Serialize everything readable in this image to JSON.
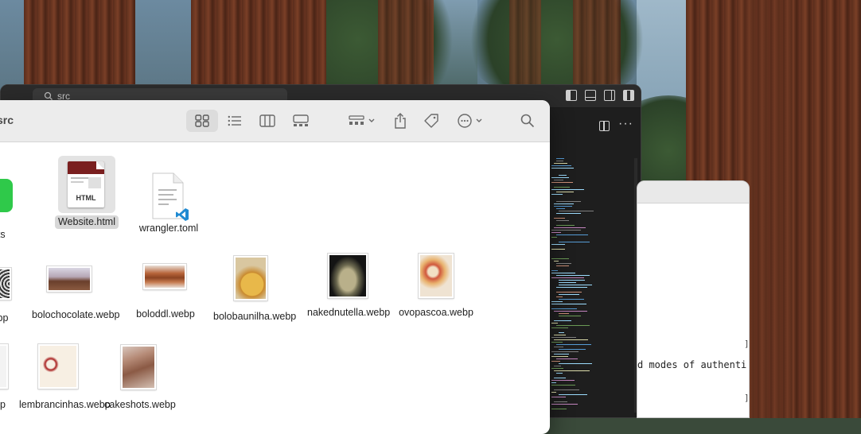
{
  "editor": {
    "command_center_text": "src",
    "layout_icons": [
      "toggle-primary-sidebar-icon",
      "toggle-panel-icon",
      "toggle-secondary-sidebar-icon",
      "customize-layout-icon"
    ],
    "more_actions": "···"
  },
  "finder": {
    "title": "src",
    "toolbar": {
      "view_icons": [
        "icon-view-icon",
        "list-view-icon",
        "column-view-icon",
        "gallery-view-icon"
      ],
      "selected_view": "icon-view-icon",
      "group_icon": "group-by-icon",
      "share_icon": "share-icon",
      "tag_icon": "tag-icon",
      "action_icon": "more-actions-icon",
      "search_icon": "search-icon"
    },
    "files": [
      {
        "name": ".ts",
        "kind": "app-icon"
      },
      {
        "name": "Website.html",
        "kind": "html",
        "selected": true,
        "badge": "HTML"
      },
      {
        "name": "wrangler.toml",
        "kind": "toml"
      },
      {
        "name": "ebp",
        "kind": "image"
      },
      {
        "name": "bolochocolate.webp",
        "kind": "image"
      },
      {
        "name": "boloddl.webp",
        "kind": "image"
      },
      {
        "name": "bolobaunilha.webp",
        "kind": "image"
      },
      {
        "name": "nakednutella.webp",
        "kind": "image"
      },
      {
        "name": "ovopascoa.webp",
        "kind": "image"
      },
      {
        "name": "op",
        "kind": "image"
      },
      {
        "name": "lembrancinhas.webp",
        "kind": "image"
      },
      {
        "name": "cakeshots.webp",
        "kind": "image"
      }
    ]
  },
  "textwin": {
    "visible_text": "d modes of authenti",
    "bracket": "]"
  },
  "colors": {
    "finder_bg": "#ffffff",
    "toolbar_bg": "#ececec",
    "editor_bg": "#1e1e1e",
    "vscode_blue": "#1f8ad2",
    "selection_gray": "#d7d7d7"
  }
}
